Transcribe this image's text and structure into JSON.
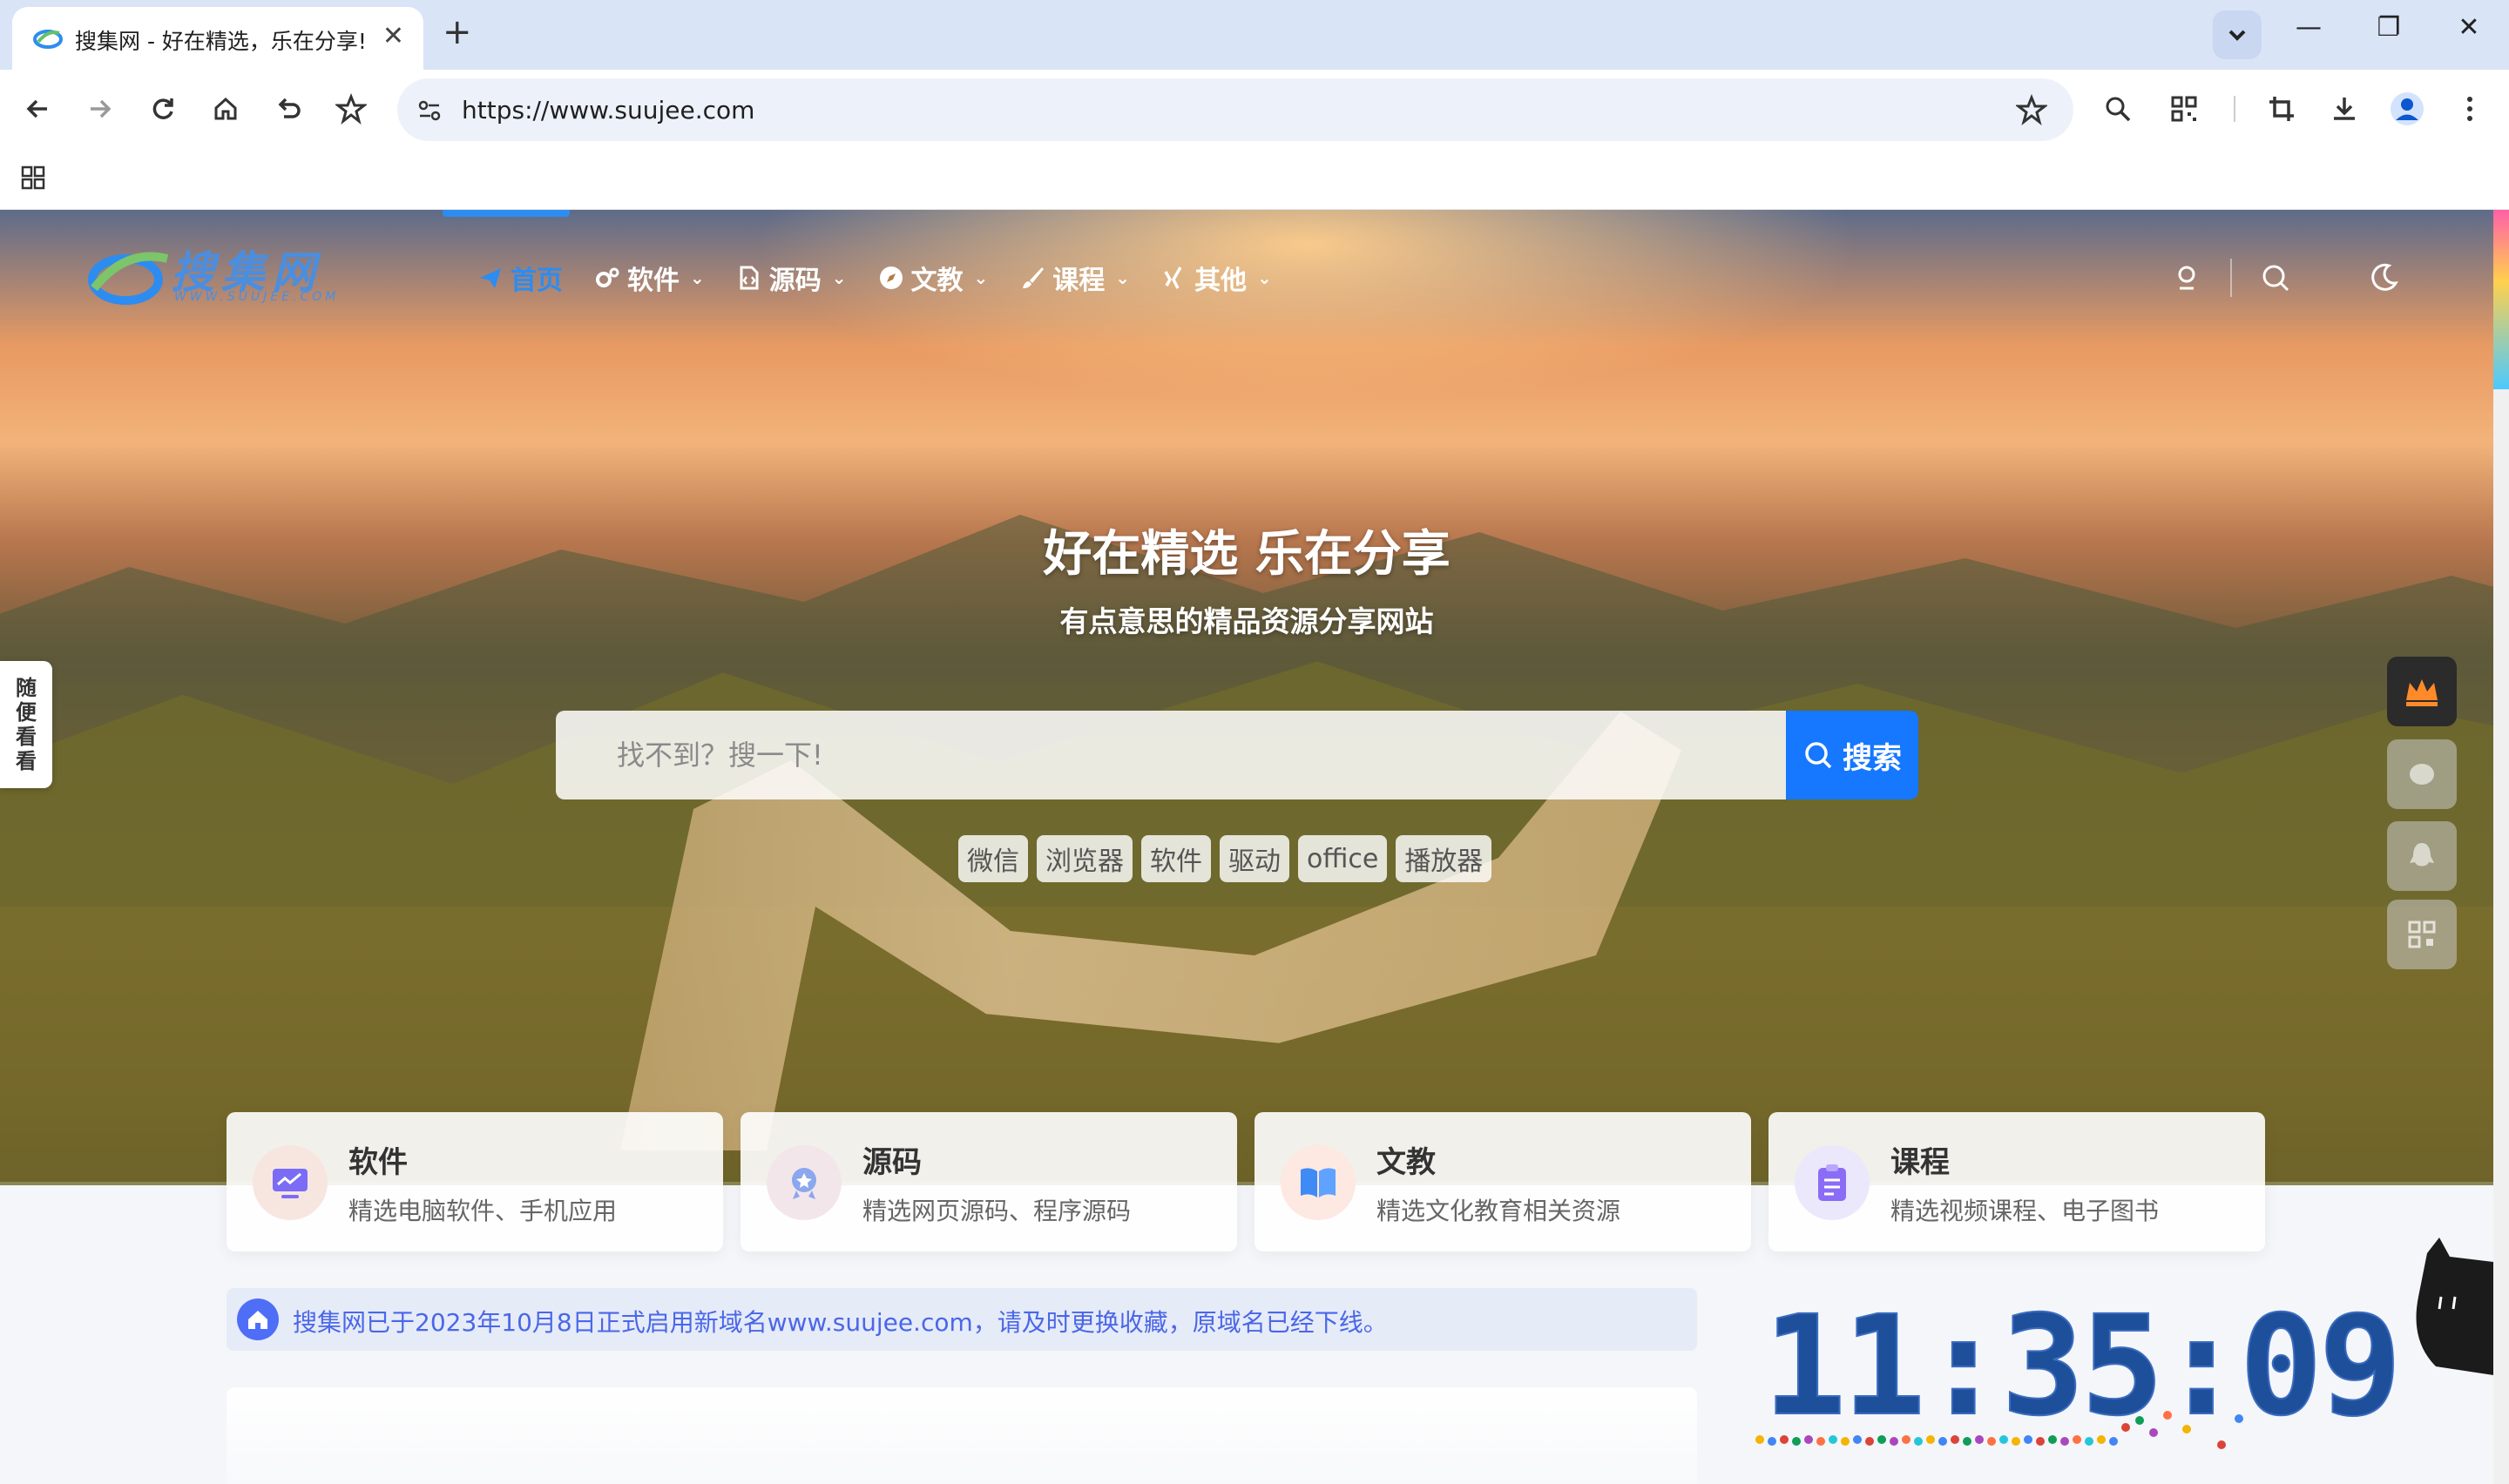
{
  "browser": {
    "tab_title": "搜集网 - 好在精选，乐在分享!",
    "tab_close": "✕",
    "new_tab": "+",
    "url": "https://www.suujee.com",
    "window_controls": {
      "minimize": "—",
      "restore": "❐",
      "close": "✕"
    }
  },
  "site": {
    "logo_text": "搜集网",
    "logo_sub": "WWW.SUUJEE.COM",
    "nav": [
      {
        "label": "首页",
        "icon": "paper-plane-icon",
        "dropdown": false
      },
      {
        "label": "软件",
        "icon": "gears-icon",
        "dropdown": true
      },
      {
        "label": "源码",
        "icon": "code-file-icon",
        "dropdown": true
      },
      {
        "label": "文教",
        "icon": "compass-icon",
        "dropdown": true
      },
      {
        "label": "课程",
        "icon": "brush-icon",
        "dropdown": true
      },
      {
        "label": "其他",
        "icon": "xing-icon",
        "dropdown": true
      }
    ],
    "slogan": "好在精选 乐在分享",
    "sub_slogan": "有点意思的精品资源分享网站",
    "search": {
      "placeholder": "找不到？搜一下!",
      "button": "搜索"
    },
    "hot_tags": [
      "微信",
      "浏览器",
      "软件",
      "驱动",
      "office",
      "播放器"
    ],
    "side_random": [
      "随",
      "便",
      "看",
      "看"
    ],
    "categories": [
      {
        "title": "软件",
        "desc": "精选电脑软件、手机应用",
        "icon": "chart-monitor-icon"
      },
      {
        "title": "源码",
        "desc": "精选网页源码、程序源码",
        "icon": "badge-icon"
      },
      {
        "title": "文教",
        "desc": "精选文化教育相关资源",
        "icon": "book-icon"
      },
      {
        "title": "课程",
        "desc": "精选视频课程、电子图书",
        "icon": "clipboard-icon"
      }
    ],
    "notice": "搜集网已于2023年10月8日正式启用新域名www.suujee.com，请及时更换收藏，原域名已经下线。",
    "clock": "11:35:09",
    "colors": {
      "accent": "#1677ff",
      "nav_active": "#2d8cf0",
      "notice_text": "#4a67e8"
    }
  }
}
